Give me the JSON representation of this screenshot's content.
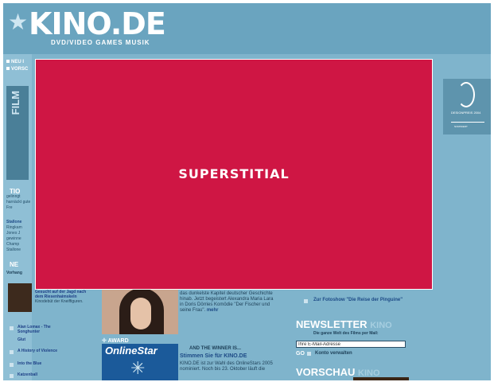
{
  "site": {
    "logo": "KINO.DE",
    "tagline": "DVD/VIDEO GAMES MUSIK"
  },
  "left_nav": [
    "NEU I",
    "VORSC"
  ],
  "left_strip": "FILM",
  "tip": {
    "title": "TIO",
    "text": "gelinngt harnäckt gute Fre",
    "text2_bold": "Stallone",
    "text2": "Ringkam Jones J gewinne Champ Stallone"
  },
  "left_new": {
    "title": "NE",
    "vorhang": "Vorhang"
  },
  "left_list": [
    {
      "label": "Gesucht auf der Jagd nach dem Riesenhaimskeln",
      "desc": "Kinodebüt der Kneiffiguren."
    },
    {
      "label": "Alan Lomax - The Songhunter"
    },
    {
      "label": "Glut"
    },
    {
      "label": "A History of Violence"
    },
    {
      "label": "Into the Blue"
    },
    {
      "label": "Katzenball"
    }
  ],
  "actress_text": "das dunkelste Kapitel deutscher Geschichte hinab. Jetzt begeistert Alexandra Maria Lara in Doris Dörries Komödie \"Der Fischer und seine Frau\".",
  "actress_more": "mehr",
  "award": {
    "label": "AWARD",
    "box": "OnlineStar",
    "winner": "AND THE WINNER IS...",
    "vote": "Stimmen Sie für KINO.DE",
    "text": "KINO.DE ist zur Wahl des OnlineStars 2005 nominiert. Noch bis 23. Oktober läuft die"
  },
  "fotoshow": "Zur Fotoshow \"Die Reise der Pinguine\"",
  "newsletter": {
    "title": "NEWSLETTER",
    "tag": "Die ganze Welt des Films per Mail:",
    "placeholder": "Ihre E-Mail-Adresse",
    "go": "GO",
    "manage": "Konto verwalten"
  },
  "vorschau": "VORSCHAU",
  "design": {
    "text": "DESIGNPREIS 2004",
    "sub": "NOMINIERT"
  },
  "overlay": {
    "label": "SUPERSTITIAL",
    "color": "#cf1644"
  }
}
